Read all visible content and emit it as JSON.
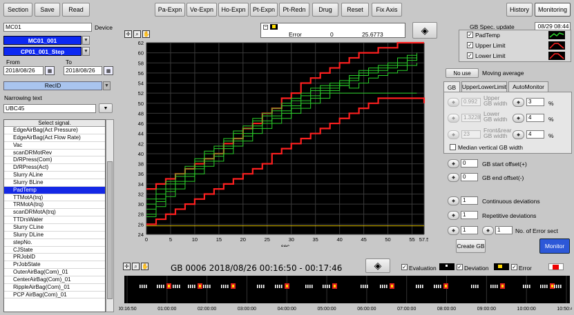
{
  "toolbar": {
    "section": "Section",
    "save": "Save",
    "read": "Read",
    "pa_expn": "Pa-Expn",
    "ve_expn": "Ve-Expn",
    "ho_expn": "Ho-Expn",
    "pt_expn": "Pt-Expn",
    "pt_redn": "Pt-Redn",
    "drug": "Drug",
    "reset": "Reset",
    "fix_axis": "Fix Axis",
    "history": "History",
    "monitoring": "Monitoring"
  },
  "left": {
    "device_value": "MC01",
    "device_label": "Device",
    "module": "MC01_001",
    "step": "CP01_001_Step",
    "from_label": "From",
    "to_label": "To",
    "from_date": "2018/08/26",
    "to_date": "2018/08/26",
    "recid": "RecID",
    "narrowing_label": "Narrowing text",
    "narrowing_value": "UBC45",
    "list_header": "Select signal.",
    "signals": [
      "EdgeAirBag(Act Pressure)",
      "EdgeAirBag(Act Flow Rate)",
      "Vac",
      "scanDRMotRev",
      "D/RPress(Com)",
      "D/RPress(Act)",
      "Slurry ALine",
      "Slurry BLine",
      "PadTemp",
      "TTMotA(trq)",
      "TRMotA(trq)",
      "scanDRMotA(trq)",
      "TTDrsWater",
      "Slurry CLine",
      "Slurry DLine",
      "stepNo.",
      "CJState",
      "PRJobID",
      "PrJobState",
      "OuterAirBag(Com)_01",
      "CenterAirBag(Com)_01",
      "RippleAirBag(Com)_01",
      "PCP AirBag(Com)_01"
    ],
    "selected_index": 8
  },
  "error_box": {
    "label": "Error",
    "count": "0",
    "value": "25.6773"
  },
  "gb": {
    "spec_label": "GB Spec. update",
    "spec_time": "08/29 08:44",
    "legend": [
      {
        "label": "PadTemp",
        "color": "#2bd12b"
      },
      {
        "label": "Upper Limit",
        "color": "#ff2020"
      },
      {
        "label": "Lower Limit",
        "color": "#ff2020"
      }
    ],
    "moving_avg_value": "No use",
    "moving_avg_label": "Moving average",
    "tabs": [
      "GB",
      "UpperLowerLimit",
      "AutoMonitor"
    ],
    "upper_value": "0.992",
    "upper_label": "Upper\nGB width",
    "upper_pct": "3",
    "lower_value": "1.3228",
    "lower_label": "Lower\nGB width",
    "lower_pct": "4",
    "fr_value": "23",
    "fr_label": "Front&rear\nGB width",
    "fr_pct": "4",
    "pct": "%",
    "median_label": "Median vertical GB width",
    "start_offset": "0",
    "start_label": "GB start offset(+)",
    "end_offset": "0",
    "end_label": "GB end offset(-)",
    "cont_dev": "1",
    "cont_label": "Continuous deviations",
    "rep_dev": "1",
    "rep_label": "Repetitive deviations",
    "err_a": "1",
    "err_b": "1",
    "err_label": "No. of Error sect",
    "create_gb": "Create GB",
    "monitor": "Monitor"
  },
  "chart_data": {
    "type": "line",
    "xlabel": "sec",
    "xlim": [
      0,
      57.5
    ],
    "ylim": [
      24,
      62
    ],
    "xticks": [
      "0",
      "5",
      "10",
      "15",
      "20",
      "25",
      "30",
      "35",
      "40",
      "45",
      "50",
      "55",
      "57.5"
    ],
    "yticks": [
      "24",
      "26",
      "28",
      "30",
      "32",
      "34",
      "36",
      "38",
      "40",
      "42",
      "44",
      "46",
      "48",
      "50",
      "52",
      "54",
      "56",
      "58",
      "60",
      "62"
    ],
    "series": [
      {
        "name": "Upper Limit",
        "color": "#ff2020",
        "points": [
          [
            0,
            33
          ],
          [
            2,
            34
          ],
          [
            4,
            35
          ],
          [
            6,
            36
          ],
          [
            8,
            37
          ],
          [
            10,
            38
          ],
          [
            12,
            39
          ],
          [
            14,
            40
          ],
          [
            16,
            42
          ],
          [
            18,
            43
          ],
          [
            20,
            45
          ],
          [
            22,
            46
          ],
          [
            24,
            48
          ],
          [
            26,
            49
          ],
          [
            28,
            51
          ],
          [
            30,
            52
          ],
          [
            32,
            54
          ],
          [
            34,
            55
          ],
          [
            36,
            56
          ],
          [
            38,
            57
          ],
          [
            40,
            58
          ],
          [
            42,
            59
          ],
          [
            44,
            60
          ],
          [
            46,
            60
          ],
          [
            48,
            61
          ],
          [
            50,
            61
          ],
          [
            52,
            62
          ],
          [
            57.5,
            62
          ]
        ]
      },
      {
        "name": "Lower Limit",
        "color": "#ff2020",
        "points": [
          [
            0,
            26
          ],
          [
            2,
            27
          ],
          [
            4,
            28
          ],
          [
            6,
            29
          ],
          [
            8,
            30
          ],
          [
            10,
            31
          ],
          [
            12,
            32
          ],
          [
            14,
            33
          ],
          [
            16,
            34
          ],
          [
            18,
            35
          ],
          [
            20,
            36
          ],
          [
            22,
            37
          ],
          [
            24,
            38
          ],
          [
            26,
            40
          ],
          [
            28,
            41
          ],
          [
            30,
            42
          ],
          [
            32,
            43
          ],
          [
            34,
            44
          ],
          [
            36,
            45
          ],
          [
            38,
            46
          ],
          [
            40,
            47
          ],
          [
            42,
            48
          ],
          [
            44,
            49
          ],
          [
            46,
            50
          ],
          [
            48,
            51
          ],
          [
            50,
            51
          ],
          [
            55,
            51
          ],
          [
            57.5,
            50
          ]
        ]
      },
      {
        "name": "PadTemp",
        "color": "#2bd12b",
        "points": [
          [
            0,
            29
          ],
          [
            2,
            31
          ],
          [
            4,
            33
          ],
          [
            6,
            34.5
          ],
          [
            8,
            36
          ],
          [
            10,
            37.5
          ],
          [
            12,
            39
          ],
          [
            14,
            40
          ],
          [
            16,
            41.5
          ],
          [
            18,
            43
          ],
          [
            20,
            44
          ],
          [
            22,
            45.5
          ],
          [
            24,
            46.5
          ],
          [
            26,
            47.5
          ],
          [
            28,
            48.5
          ],
          [
            30,
            49.5
          ],
          [
            32,
            50.5
          ],
          [
            34,
            51.5
          ],
          [
            36,
            52.5
          ],
          [
            38,
            53
          ],
          [
            40,
            54
          ],
          [
            42,
            55
          ],
          [
            44,
            56
          ],
          [
            46,
            56.5
          ],
          [
            48,
            57
          ],
          [
            50,
            57.5
          ],
          [
            52,
            58
          ],
          [
            54,
            59
          ],
          [
            56,
            59.5
          ]
        ]
      },
      {
        "name": "PadTemp",
        "color": "#2bd12b",
        "points": [
          [
            0,
            28
          ],
          [
            2,
            30.5
          ],
          [
            4,
            32.5
          ],
          [
            6,
            34
          ],
          [
            8,
            35.5
          ],
          [
            10,
            37
          ],
          [
            12,
            38.5
          ],
          [
            14,
            39.5
          ],
          [
            16,
            41
          ],
          [
            18,
            42.5
          ],
          [
            20,
            43.5
          ],
          [
            22,
            45
          ],
          [
            24,
            46
          ],
          [
            26,
            47
          ],
          [
            28,
            48
          ],
          [
            30,
            49
          ],
          [
            32,
            50
          ],
          [
            34,
            51
          ],
          [
            36,
            52
          ],
          [
            38,
            52.5
          ],
          [
            40,
            53.5
          ],
          [
            42,
            54.5
          ],
          [
            44,
            55.5
          ],
          [
            46,
            56
          ],
          [
            48,
            56.5
          ],
          [
            50,
            57
          ],
          [
            52,
            57.5
          ],
          [
            54,
            58.5
          ],
          [
            56,
            59
          ]
        ]
      },
      {
        "name": "PadTemp",
        "color": "#2bd12b",
        "points": [
          [
            0,
            30
          ],
          [
            2,
            32
          ],
          [
            4,
            34
          ],
          [
            6,
            35.5
          ],
          [
            8,
            37
          ],
          [
            10,
            38.5
          ],
          [
            12,
            40
          ],
          [
            14,
            41
          ],
          [
            16,
            42.5
          ],
          [
            18,
            44
          ],
          [
            20,
            45
          ],
          [
            22,
            46.5
          ],
          [
            24,
            47.5
          ],
          [
            26,
            48.5
          ],
          [
            28,
            49.5
          ],
          [
            30,
            50.5
          ],
          [
            32,
            51.5
          ],
          [
            34,
            52.5
          ],
          [
            36,
            53
          ],
          [
            38,
            53.5
          ],
          [
            40,
            54.5
          ],
          [
            42,
            55.5
          ],
          [
            44,
            56.5
          ],
          [
            46,
            57
          ],
          [
            48,
            57.5
          ],
          [
            50,
            58
          ],
          [
            52,
            59
          ],
          [
            54,
            59.5
          ],
          [
            56,
            60
          ]
        ]
      },
      {
        "name": "PadTemp",
        "color": "#2bd12b",
        "points": [
          [
            0,
            27.5
          ],
          [
            2,
            29.5
          ],
          [
            4,
            31.5
          ],
          [
            6,
            33
          ],
          [
            8,
            34.5
          ],
          [
            10,
            36
          ],
          [
            12,
            37.5
          ],
          [
            14,
            38.5
          ],
          [
            16,
            40
          ],
          [
            18,
            41.5
          ],
          [
            20,
            42.5
          ],
          [
            22,
            44
          ],
          [
            24,
            45
          ],
          [
            26,
            46
          ],
          [
            28,
            47
          ],
          [
            30,
            48
          ],
          [
            32,
            49
          ],
          [
            34,
            50
          ],
          [
            36,
            51
          ],
          [
            38,
            52
          ],
          [
            40,
            52
          ],
          [
            42,
            52
          ],
          [
            44,
            52
          ],
          [
            46,
            52
          ],
          [
            48,
            52
          ],
          [
            50,
            52
          ],
          [
            52,
            52
          ],
          [
            54,
            52
          ],
          [
            56,
            52
          ]
        ]
      },
      {
        "name": "PadTemp",
        "color": "#2bd12b",
        "points": [
          [
            0,
            31
          ],
          [
            2,
            33
          ],
          [
            4,
            34.5
          ],
          [
            6,
            36
          ],
          [
            8,
            37.5
          ],
          [
            10,
            39
          ],
          [
            12,
            40.5
          ],
          [
            14,
            41.5
          ],
          [
            16,
            43
          ],
          [
            18,
            44.5
          ],
          [
            20,
            45.5
          ],
          [
            22,
            47
          ],
          [
            24,
            48
          ],
          [
            26,
            49
          ],
          [
            28,
            50
          ],
          [
            30,
            51
          ],
          [
            32,
            52
          ],
          [
            34,
            53
          ],
          [
            36,
            53.5
          ],
          [
            38,
            54
          ],
          [
            40,
            53.5
          ],
          [
            42,
            53
          ],
          [
            44,
            54
          ],
          [
            46,
            55
          ],
          [
            48,
            55.5
          ],
          [
            50,
            56
          ],
          [
            52,
            56.5
          ],
          [
            54,
            57.5
          ],
          [
            56,
            58
          ]
        ]
      }
    ]
  },
  "timeline": {
    "title": "GB 0006 2018/08/26 00:16:50 - 00:17:46",
    "legend": [
      {
        "label": "Evaluation"
      },
      {
        "label": "Deviation"
      },
      {
        "label": "Error"
      }
    ],
    "ticks": [
      "00:16:50",
      "01:00:00",
      "02:00:00",
      "03:00:00",
      "04:00:00",
      "05:00:00",
      "06:00:00",
      "07:00:00",
      "08:00:00",
      "09:00:00",
      "10:00:00",
      "10:50:45"
    ]
  }
}
